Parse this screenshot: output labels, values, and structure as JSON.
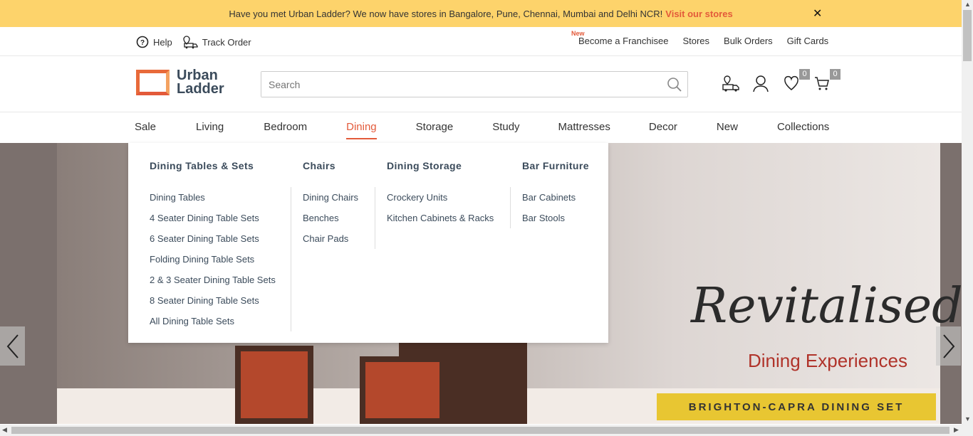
{
  "promo": {
    "text": "Have you met Urban Ladder? We now have stores in Bangalore, Pune, Chennai, Mumbai and Delhi NCR!",
    "link": "Visit our stores",
    "close_icon": "close-icon"
  },
  "topbar": {
    "help": "Help",
    "track_order": "Track Order",
    "new_tag": "New",
    "links": [
      "Become a Franchisee",
      "Stores",
      "Bulk Orders",
      "Gift Cards"
    ]
  },
  "header": {
    "logo_line1": "Urban",
    "logo_line2": "Ladder",
    "search_placeholder": "Search",
    "wishlist_count": "0",
    "cart_count": "0"
  },
  "nav": {
    "items": [
      "Sale",
      "Living",
      "Bedroom",
      "Dining",
      "Storage",
      "Study",
      "Mattresses",
      "Decor",
      "New",
      "Collections"
    ],
    "active": "Dining"
  },
  "mega_menu": {
    "columns": [
      {
        "title": "Dining Tables & Sets",
        "links": [
          "Dining Tables",
          "4 Seater Dining Table Sets",
          "6 Seater Dining Table Sets",
          "Folding Dining Table Sets",
          "2 & 3 Seater Dining Table Sets",
          "8 Seater Dining Table Sets",
          "All Dining Table Sets"
        ]
      },
      {
        "title": "Chairs",
        "links": [
          "Dining Chairs",
          "Benches",
          "Chair Pads"
        ]
      },
      {
        "title": "Dining Storage",
        "links": [
          "Crockery Units",
          "Kitchen Cabinets & Racks"
        ]
      },
      {
        "title": "Bar Furniture",
        "links": [
          "Bar Cabinets",
          "Bar Stools"
        ]
      }
    ]
  },
  "hero": {
    "headline": "Revitalised",
    "subline": "Dining Experiences",
    "banner": "BRIGHTON-CAPRA DINING SET"
  },
  "colors": {
    "promo_bg": "#fdd36b",
    "accent": "#e35a3a",
    "banner_yellow": "#e8c632"
  }
}
